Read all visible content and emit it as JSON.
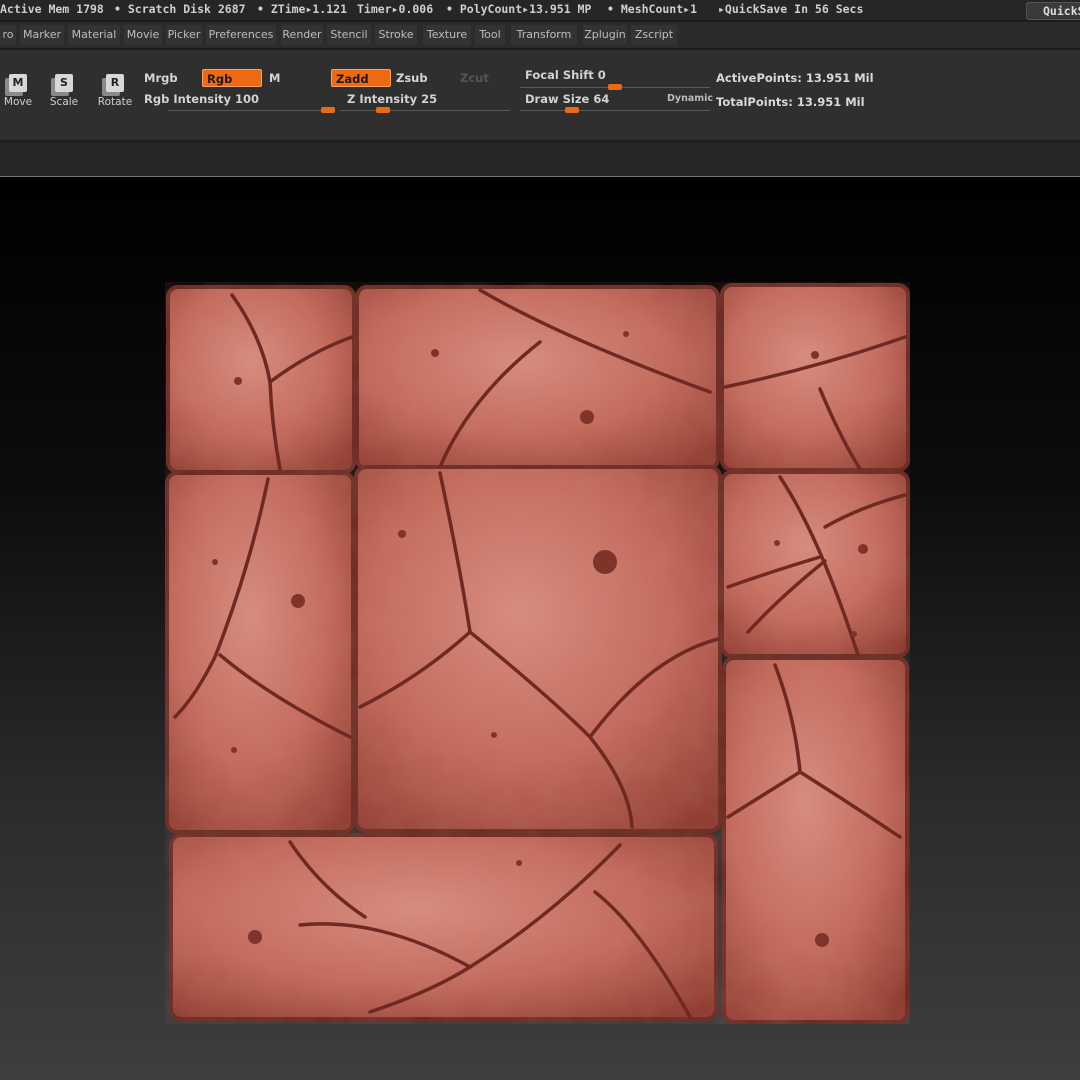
{
  "status_bar": {
    "active_mem": "Active Mem 1798",
    "scratch_disk": "• Scratch Disk 2687",
    "ztime": "• ZTime▸1.121",
    "timer": "Timer▸0.006",
    "polycount": "• PolyCount▸13.951 MP",
    "meshcount": "• MeshCount▸1",
    "quicksave_status": "▸QuickSave In 56 Secs",
    "quicksave_button": "QuickSave"
  },
  "menu": [
    "ro",
    "Marker",
    "Material",
    "Movie",
    "Picker",
    "Preferences",
    "Render",
    "Stencil",
    "Stroke",
    "Texture",
    "Tool",
    "Transform",
    "Zplugin",
    "Zscript"
  ],
  "tools": {
    "move": {
      "key": "M",
      "label": "Move"
    },
    "scale": {
      "key": "S",
      "label": "Scale"
    },
    "rotate": {
      "key": "R",
      "label": "Rotate"
    }
  },
  "color_modes": {
    "mrgb": "Mrgb",
    "rgb": "Rgb",
    "m": "M",
    "active": "Rgb"
  },
  "sculpt_modes": {
    "zadd": "Zadd",
    "zsub": "Zsub",
    "zcut": "Zcut",
    "active": "Zadd"
  },
  "sliders": {
    "rgb_intensity": {
      "label": "Rgb Intensity 100",
      "value": 100,
      "max": 100
    },
    "z_intensity": {
      "label": "Z Intensity 25",
      "value": 25,
      "max": 100
    },
    "focal_shift": {
      "label": "Focal Shift 0",
      "value": 0,
      "min": -100,
      "max": 100
    },
    "draw_size": {
      "label": "Draw Size 64",
      "value": 64
    }
  },
  "dynamic_label": "Dynamic",
  "stats": {
    "active_points": "ActivePoints: 13.951 Mil",
    "total_points": "TotalPoints: 13.951 Mil"
  },
  "colors": {
    "accent": "#ee6a12",
    "clay": "#b8584a",
    "clay_shadow": "#6a2a22",
    "clay_highlight": "#dc9a8e"
  }
}
